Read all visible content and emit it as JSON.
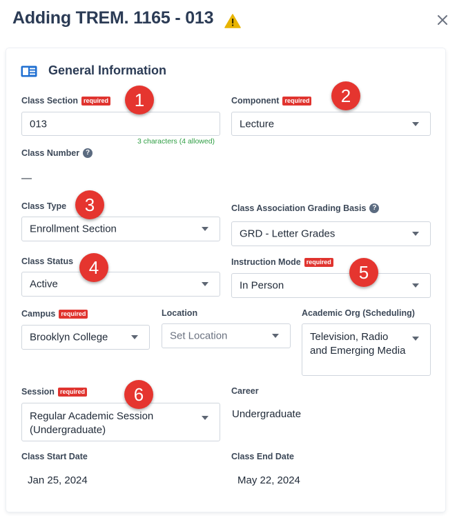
{
  "header": {
    "title": "Adding TREM. 1165 - 013",
    "warning_icon": "warning-triangle-icon",
    "close_icon": "close-icon"
  },
  "section": {
    "title": "General Information",
    "icon": "book-open-icon"
  },
  "required_tag": "required",
  "fields": {
    "class_section": {
      "label": "Class Section",
      "value": "013",
      "hint": "3 characters (4 allowed)"
    },
    "component": {
      "label": "Component",
      "value": "Lecture"
    },
    "class_number": {
      "label": "Class Number",
      "value": "—"
    },
    "class_type": {
      "label": "Class Type",
      "value": "Enrollment Section"
    },
    "grading_basis": {
      "label": "Class Association Grading Basis",
      "value": "GRD - Letter Grades"
    },
    "class_status": {
      "label": "Class Status",
      "value": "Active"
    },
    "instruction_mode": {
      "label": "Instruction Mode",
      "value": "In Person"
    },
    "campus": {
      "label": "Campus",
      "value": "Brooklyn College"
    },
    "location": {
      "label": "Location",
      "placeholder": "Set Location"
    },
    "academic_org": {
      "label": "Academic Org (Scheduling)",
      "value": "Television, Radio and Emerging Media"
    },
    "session": {
      "label": "Session",
      "value": "Regular Academic Session (Undergraduate)"
    },
    "career": {
      "label": "Career",
      "value": "Undergraduate"
    },
    "start_date": {
      "label": "Class Start Date",
      "value": "Jan 25, 2024"
    },
    "end_date": {
      "label": "Class End Date",
      "value": "May 22, 2024"
    }
  },
  "annotations": [
    "1",
    "2",
    "3",
    "4",
    "5",
    "6"
  ],
  "colors": {
    "title": "#2b3b55",
    "required_bg": "#e0342f",
    "hint_green": "#2f9e44",
    "badge_red": "#e5352f",
    "warning_yellow": "#e8b400",
    "section_icon_blue": "#1f6fd1"
  }
}
